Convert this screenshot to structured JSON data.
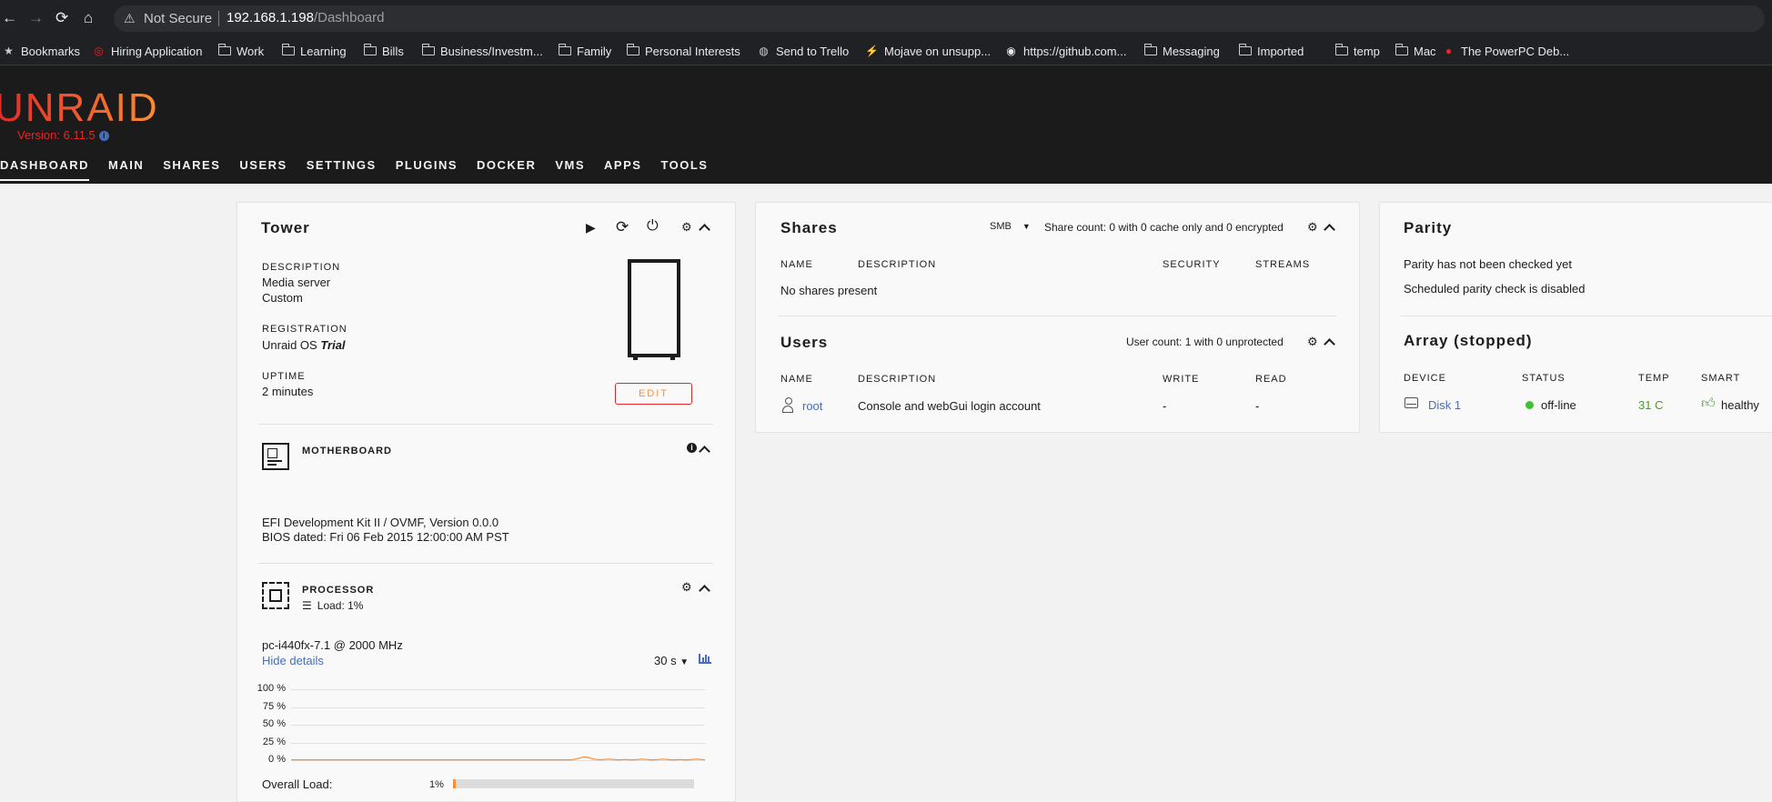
{
  "browser": {
    "not_secure": "Not Secure",
    "url_host": "192.168.1.198",
    "url_path": "/Dashboard",
    "bookmarks": [
      {
        "label": "Bookmarks",
        "icon": "star-icon"
      },
      {
        "label": "Hiring Application",
        "icon": "oracle-icon"
      },
      {
        "label": "Work",
        "icon": "folder-icon"
      },
      {
        "label": "Learning",
        "icon": "folder-icon"
      },
      {
        "label": "Bills",
        "icon": "folder-icon"
      },
      {
        "label": "Business/Investm...",
        "icon": "folder-icon"
      },
      {
        "label": "Family",
        "icon": "folder-icon"
      },
      {
        "label": "Personal Interests",
        "icon": "folder-icon"
      },
      {
        "label": "Send to Trello",
        "icon": "globe-icon"
      },
      {
        "label": "Mojave on unsupp...",
        "icon": "bolt-icon"
      },
      {
        "label": "https://github.com...",
        "icon": "github-icon"
      },
      {
        "label": "Messaging",
        "icon": "folder-icon"
      },
      {
        "label": "Imported",
        "icon": "folder-icon"
      },
      {
        "label": "temp",
        "icon": "folder-icon"
      },
      {
        "label": "Mac",
        "icon": "folder-icon"
      },
      {
        "label": "The PowerPC Deb...",
        "icon": "apple-icon"
      }
    ]
  },
  "header": {
    "logo": "UNRAID",
    "version": "Version: 6.11.5",
    "menu": [
      "DASHBOARD",
      "MAIN",
      "SHARES",
      "USERS",
      "SETTINGS",
      "PLUGINS",
      "DOCKER",
      "VMS",
      "APPS",
      "TOOLS"
    ],
    "active_menu": "DASHBOARD"
  },
  "tower": {
    "title": "Tower",
    "description_label": "DESCRIPTION",
    "description_line1": "Media server",
    "description_line2": "Custom",
    "registration_label": "REGISTRATION",
    "registration_value": "Unraid OS ",
    "registration_type": "Trial",
    "uptime_label": "UPTIME",
    "uptime_value": "2 minutes",
    "edit_label": "EDIT",
    "motherboard_label": "MOTHERBOARD",
    "motherboard_line1": "EFI Development Kit II / OVMF, Version 0.0.0",
    "motherboard_line2": "BIOS dated: Fri 06 Feb 2015 12:00:00 AM PST",
    "processor_label": "PROCESSOR",
    "processor_load": "Load: 1%",
    "processor_name": "pc-i440fx-7.1 @ 2000 MHz",
    "hide_details": "Hide details",
    "interval": "30 s",
    "overall_load_label": "Overall Load:",
    "overall_load_value": "1%",
    "overall_load_fraction": 0.01
  },
  "chart_data": {
    "type": "line",
    "title": "",
    "xlabel": "",
    "ylabel": "",
    "y_ticks": [
      "100 %",
      "75 %",
      "50 %",
      "25 %",
      "0 %"
    ],
    "ylim": [
      0,
      100
    ],
    "series": [
      {
        "values": [
          0.5,
          0.5,
          0.5,
          0.5,
          0.5,
          0.5,
          0.5,
          0.5,
          0.5,
          0.5,
          0.5,
          0.5,
          0.5,
          0.5,
          0.5,
          0.5,
          0.5,
          0.5,
          0.5,
          0.5,
          0.5,
          0.5,
          0.5,
          0.5,
          0.5,
          0.5,
          0.5,
          0.5,
          0.5,
          0.5,
          0.5,
          0.5,
          0.5,
          0.5,
          0.5,
          0.5,
          0.5,
          0.5,
          0.5,
          0.5,
          0.5,
          0.5,
          0.5,
          0.5,
          0.5,
          0.5,
          0.5,
          0.5,
          0.5,
          0.5,
          0.5,
          0.5,
          0.5,
          0.5,
          0.5,
          0.5,
          0.5,
          0.5,
          0.5,
          0.5,
          0.5,
          0.5,
          0.5,
          0.5,
          0.5,
          0.5,
          0.5,
          0.5,
          1.5,
          3,
          4.5,
          4,
          2,
          1,
          0.5,
          1,
          1.5,
          1,
          0.5,
          0.5,
          1,
          0.5,
          0.5,
          1,
          1.5,
          1,
          0.5,
          0.5,
          1,
          1.5,
          1,
          0.5,
          0.5,
          1,
          0.5,
          0.5,
          1,
          1.5,
          1,
          0.5
        ]
      }
    ],
    "line_color": "#ff8c2f"
  },
  "shares": {
    "title": "Shares",
    "protocol": "SMB",
    "count_text": "Share count: 0 with 0 cache only and 0 encrypted",
    "columns": [
      "NAME",
      "DESCRIPTION",
      "SECURITY",
      "STREAMS"
    ],
    "empty": "No shares present"
  },
  "users": {
    "title": "Users",
    "count_text": "User count: 1 with 0 unprotected",
    "columns": [
      "NAME",
      "DESCRIPTION",
      "WRITE",
      "READ"
    ],
    "rows": [
      {
        "name": "root",
        "description": "Console and webGui login account",
        "write": "-",
        "read": "-"
      }
    ]
  },
  "parity": {
    "title": "Parity",
    "line1": "Parity has not been checked yet",
    "line2": "Scheduled parity check is disabled"
  },
  "array": {
    "title": "Array (stopped)",
    "columns": [
      "DEVICE",
      "STATUS",
      "TEMP",
      "SMART"
    ],
    "rows": [
      {
        "device": "Disk 1",
        "status": "off-line",
        "temp": "31 C",
        "smart": "healthy"
      }
    ]
  },
  "colors": {
    "accent_red": "#e22828",
    "accent_orange": "#ff8c2f",
    "link_blue": "#486dba",
    "ok_green": "#3cc42c"
  }
}
